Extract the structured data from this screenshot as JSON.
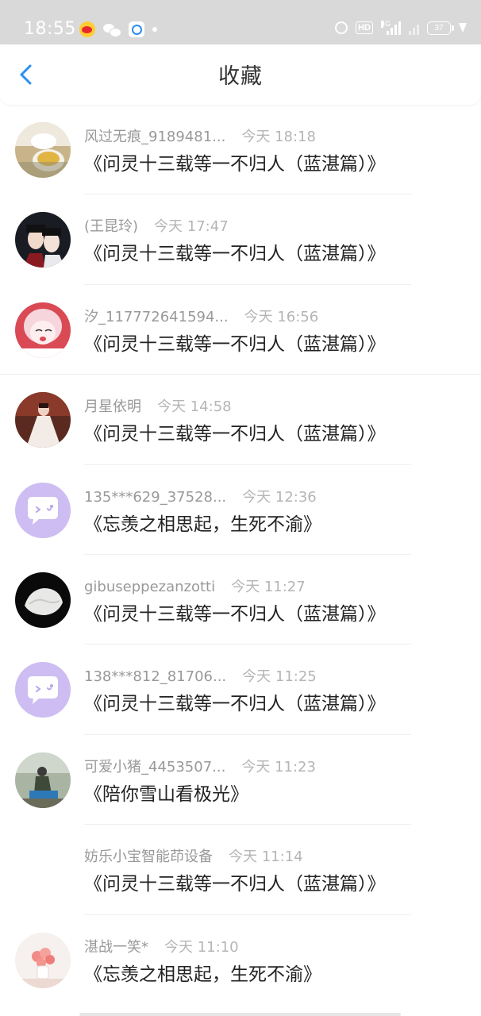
{
  "status_bar": {
    "time": "18:55",
    "left_icons": [
      "weibo-icon",
      "wechat-icon",
      "app-icon",
      "dot-icon"
    ],
    "right_icons": [
      "alarm-icon",
      "hd-icon",
      "signal-icon",
      "signal-icon",
      "battery-icon",
      "charging-icon"
    ],
    "hd_label": "HD",
    "network_label": "4G",
    "battery_level": "37"
  },
  "header": {
    "back_icon": "chevron-left-icon",
    "title": "收藏",
    "accent_color": "#2b8ef0"
  },
  "items": [
    {
      "avatar": "tea-avatar",
      "name": "风过无痕_9189481...",
      "time": "今天 18:18",
      "content": "《问灵十三载等一不归人（蓝湛篇）》"
    },
    {
      "avatar": "couple-avatar",
      "name": "(王昆玲)",
      "time": "今天 17:47",
      "content": "《问灵十三载等一不归人（蓝湛篇）》"
    },
    {
      "avatar": "anime-girl-avatar",
      "name": "汐_117772641594...",
      "time": "今天 16:56",
      "content": "《问灵十三载等一不归人（蓝湛篇）》"
    },
    {
      "avatar": "dress-avatar",
      "name": "月星依明",
      "time": "今天 14:58",
      "content": "《问灵十三载等一不归人（蓝湛篇）》"
    },
    {
      "avatar": "default-chat-avatar",
      "name": "135***629_37528...",
      "time": "今天 12:36",
      "content": "《忘羡之相思起，生死不渝》"
    },
    {
      "avatar": "white-object-avatar",
      "name": "gibuseppezanzotti",
      "time": "今天 11:27",
      "content": "《问灵十三载等一不归人（蓝湛篇）》"
    },
    {
      "avatar": "default-chat-avatar",
      "name": "138***812_81706...",
      "time": "今天 11:25",
      "content": "《问灵十三载等一不归人（蓝湛篇）》"
    },
    {
      "avatar": "outdoor-avatar",
      "name": "可爱小猪_4453507...",
      "time": "今天 11:23",
      "content": "《陪你雪山看极光》"
    },
    {
      "avatar": "none",
      "name": "妨乐小宝智能茚设备",
      "time": "今天 11:14",
      "content": "《问灵十三载等一不归人（蓝湛篇）》"
    },
    {
      "avatar": "flower-avatar",
      "name": "湛战一笑*",
      "time": "今天 11:10",
      "content": "《忘羡之相思起，生死不渝》"
    }
  ]
}
